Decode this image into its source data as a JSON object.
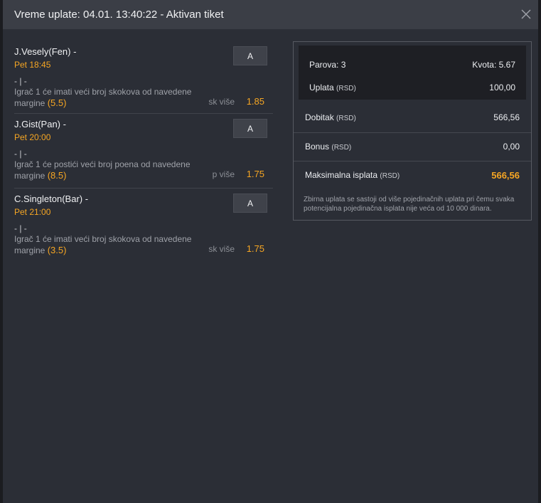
{
  "header": {
    "title": "Vreme uplate: 04.01. 13:40:22 - Aktivan tiket"
  },
  "bets": [
    {
      "name": "J.Vesely(Fen) -",
      "time": "Pet 18:45",
      "separator": "- | -",
      "desc_text": "Igrač 1 će imati veći broj skokova od navedene margine",
      "margin": "(5.5)",
      "type": "sk više",
      "odd": "1.85",
      "result": "A"
    },
    {
      "name": "J.Gist(Pan) -",
      "time": "Pet 20:00",
      "separator": "- | -",
      "desc_text": "Igrač 1 će postići veći broj poena od navedene margine",
      "margin": "(8.5)",
      "type": "p više",
      "odd": "1.75",
      "result": "A"
    },
    {
      "name": "C.Singleton(Bar) -",
      "time": "Pet 21:00",
      "separator": "- | -",
      "desc_text": "Igrač 1 će imati veći broj skokova od navedene margine",
      "margin": "(3.5)",
      "type": "sk više",
      "odd": "1.75",
      "result": "A"
    }
  ],
  "summary": {
    "pairs_label": "Parova: 3",
    "odds_label": "Kvota: 5.67",
    "stake_label": "Uplata",
    "stake_unit": "(RSD)",
    "stake_value": "100,00",
    "win_label": "Dobitak",
    "win_unit": "(RSD)",
    "win_value": "566,56",
    "bonus_label": "Bonus",
    "bonus_unit": "(RSD)",
    "bonus_value": "0,00",
    "max_label": "Maksimalna isplata",
    "max_unit": "(RSD)",
    "max_value": "566,56",
    "note": "Zbirna uplata se sastoji od više pojedinačnih uplata pri čemu svaka potencijalna pojedinačna isplata nije veća od 10 000 dinara."
  },
  "colors": {
    "accent": "#f6a623",
    "background": "#2b2e36",
    "header": "#3b3e46"
  }
}
